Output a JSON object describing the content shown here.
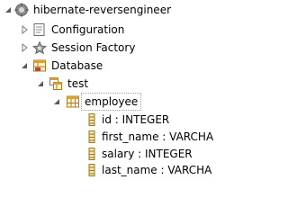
{
  "tree": {
    "root": {
      "label": "hibernate-reversengineer",
      "icon": "hibernate-config-icon",
      "expanded": true
    },
    "children": [
      {
        "label": "Configuration",
        "icon": "configuration-icon",
        "expanded": false
      },
      {
        "label": "Session Factory",
        "icon": "session-factory-icon",
        "expanded": false
      },
      {
        "label": "Database",
        "icon": "database-icon",
        "expanded": true
      }
    ],
    "schema": {
      "label": "test",
      "icon": "schema-icon",
      "expanded": true
    },
    "table": {
      "label": "employee",
      "icon": "table-icon",
      "expanded": true
    },
    "columns": [
      {
        "label": "id : INTEGER",
        "icon": "column-icon"
      },
      {
        "label": "first_name : VARCHA",
        "icon": "column-icon"
      },
      {
        "label": "salary : INTEGER",
        "icon": "column-icon"
      },
      {
        "label": "last_name : VARCHA",
        "icon": "column-icon"
      }
    ]
  },
  "colors": {
    "twisty": "#7a7a7a",
    "selection_border": "#a0a0a0"
  }
}
